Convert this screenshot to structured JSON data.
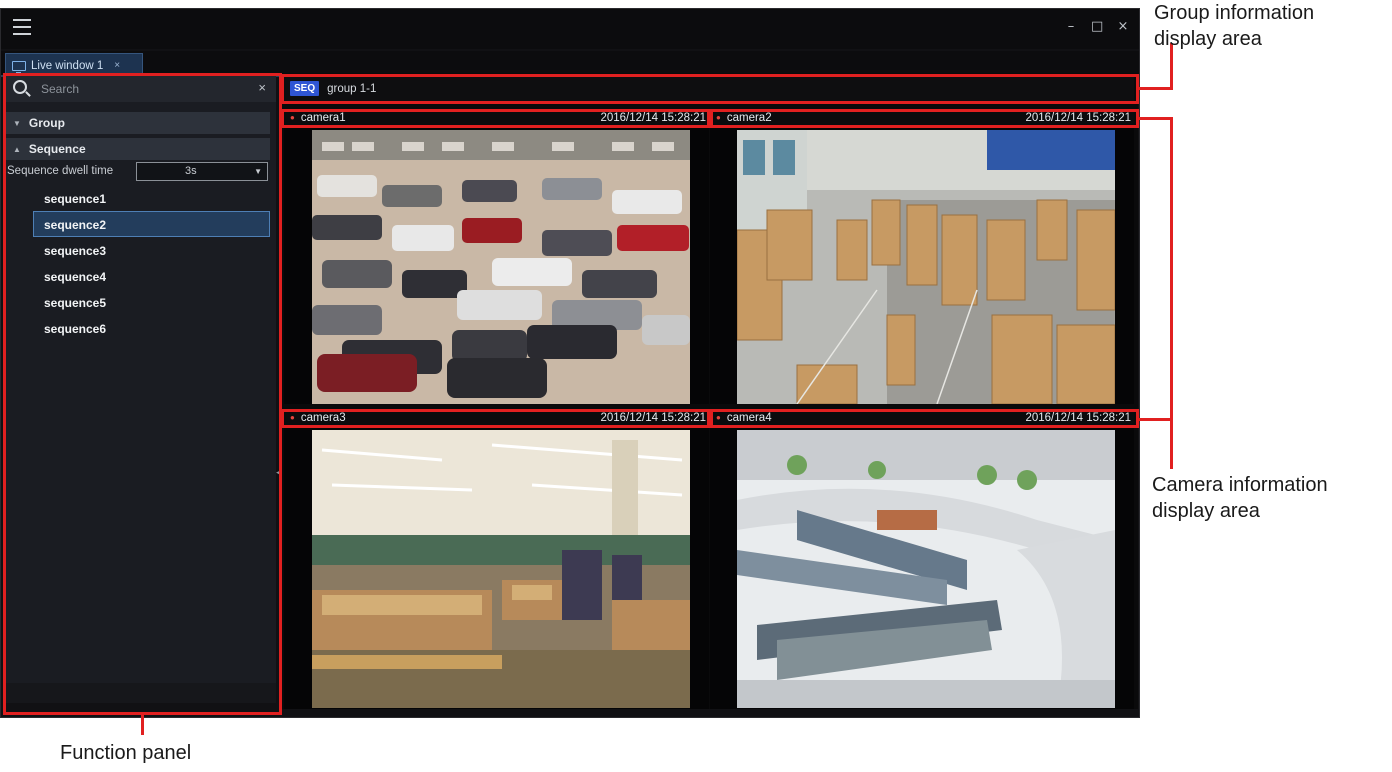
{
  "window": {
    "tab_label": "Live window 1",
    "tab_close": "×",
    "minimize": "–",
    "maximize": "□",
    "close": "×"
  },
  "panel": {
    "search_placeholder": "Search",
    "search_clear": "×",
    "group_label": "Group",
    "sequence_label": "Sequence",
    "dwell_label": "Sequence dwell time",
    "dwell_value": "3s",
    "sequences": [
      {
        "label": "sequence1",
        "selected": false
      },
      {
        "label": "sequence2",
        "selected": true
      },
      {
        "label": "sequence3",
        "selected": false
      },
      {
        "label": "sequence4",
        "selected": false
      },
      {
        "label": "sequence5",
        "selected": false
      },
      {
        "label": "sequence6",
        "selected": false
      }
    ]
  },
  "group_bar": {
    "badge": "SEQ",
    "name": "group 1-1"
  },
  "cameras": [
    {
      "name": "camera1",
      "timestamp": "2016/12/14 15:28:21",
      "scene": "parking lot"
    },
    {
      "name": "camera2",
      "timestamp": "2016/12/14 15:28:21",
      "scene": "warehouse"
    },
    {
      "name": "camera3",
      "timestamp": "2016/12/14 15:28:21",
      "scene": "supermarket"
    },
    {
      "name": "camera4",
      "timestamp": "2016/12/14 15:28:21",
      "scene": "shopping mall"
    }
  ],
  "callouts": {
    "group_info_line1": "Group information",
    "group_info_line2": "display area",
    "camera_info_line1": "Camera information",
    "camera_info_line2": "display area",
    "function_panel": "Function panel"
  },
  "colors": {
    "annotation": "#e12020",
    "seq_badge": "#2f55d4",
    "selected_item": "#233d5c",
    "rec_dot": "#e5453e"
  }
}
